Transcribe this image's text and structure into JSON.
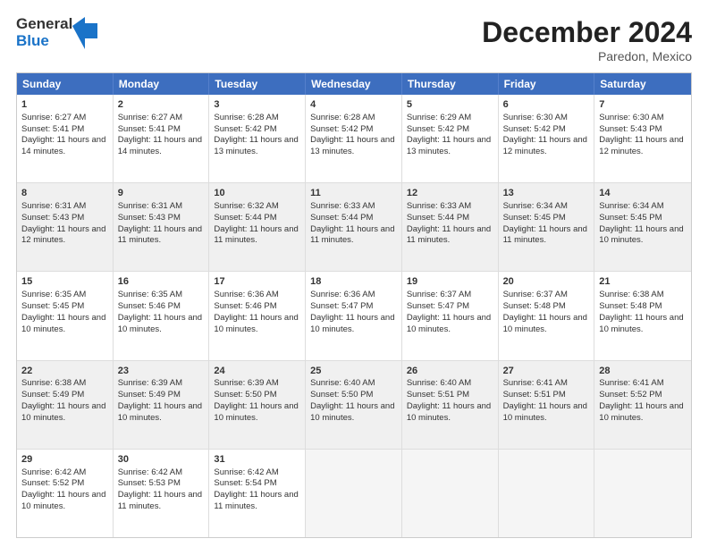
{
  "logo": {
    "line1": "General",
    "line2": "Blue"
  },
  "title": "December 2024",
  "location": "Paredon, Mexico",
  "header": {
    "days": [
      "Sunday",
      "Monday",
      "Tuesday",
      "Wednesday",
      "Thursday",
      "Friday",
      "Saturday"
    ]
  },
  "rows": [
    {
      "shaded": false,
      "cells": [
        {
          "day": "1",
          "sunrise": "Sunrise: 6:27 AM",
          "sunset": "Sunset: 5:41 PM",
          "daylight": "Daylight: 11 hours and 14 minutes."
        },
        {
          "day": "2",
          "sunrise": "Sunrise: 6:27 AM",
          "sunset": "Sunset: 5:41 PM",
          "daylight": "Daylight: 11 hours and 14 minutes."
        },
        {
          "day": "3",
          "sunrise": "Sunrise: 6:28 AM",
          "sunset": "Sunset: 5:42 PM",
          "daylight": "Daylight: 11 hours and 13 minutes."
        },
        {
          "day": "4",
          "sunrise": "Sunrise: 6:28 AM",
          "sunset": "Sunset: 5:42 PM",
          "daylight": "Daylight: 11 hours and 13 minutes."
        },
        {
          "day": "5",
          "sunrise": "Sunrise: 6:29 AM",
          "sunset": "Sunset: 5:42 PM",
          "daylight": "Daylight: 11 hours and 13 minutes."
        },
        {
          "day": "6",
          "sunrise": "Sunrise: 6:30 AM",
          "sunset": "Sunset: 5:42 PM",
          "daylight": "Daylight: 11 hours and 12 minutes."
        },
        {
          "day": "7",
          "sunrise": "Sunrise: 6:30 AM",
          "sunset": "Sunset: 5:43 PM",
          "daylight": "Daylight: 11 hours and 12 minutes."
        }
      ]
    },
    {
      "shaded": true,
      "cells": [
        {
          "day": "8",
          "sunrise": "Sunrise: 6:31 AM",
          "sunset": "Sunset: 5:43 PM",
          "daylight": "Daylight: 11 hours and 12 minutes."
        },
        {
          "day": "9",
          "sunrise": "Sunrise: 6:31 AM",
          "sunset": "Sunset: 5:43 PM",
          "daylight": "Daylight: 11 hours and 11 minutes."
        },
        {
          "day": "10",
          "sunrise": "Sunrise: 6:32 AM",
          "sunset": "Sunset: 5:44 PM",
          "daylight": "Daylight: 11 hours and 11 minutes."
        },
        {
          "day": "11",
          "sunrise": "Sunrise: 6:33 AM",
          "sunset": "Sunset: 5:44 PM",
          "daylight": "Daylight: 11 hours and 11 minutes."
        },
        {
          "day": "12",
          "sunrise": "Sunrise: 6:33 AM",
          "sunset": "Sunset: 5:44 PM",
          "daylight": "Daylight: 11 hours and 11 minutes."
        },
        {
          "day": "13",
          "sunrise": "Sunrise: 6:34 AM",
          "sunset": "Sunset: 5:45 PM",
          "daylight": "Daylight: 11 hours and 11 minutes."
        },
        {
          "day": "14",
          "sunrise": "Sunrise: 6:34 AM",
          "sunset": "Sunset: 5:45 PM",
          "daylight": "Daylight: 11 hours and 10 minutes."
        }
      ]
    },
    {
      "shaded": false,
      "cells": [
        {
          "day": "15",
          "sunrise": "Sunrise: 6:35 AM",
          "sunset": "Sunset: 5:45 PM",
          "daylight": "Daylight: 11 hours and 10 minutes."
        },
        {
          "day": "16",
          "sunrise": "Sunrise: 6:35 AM",
          "sunset": "Sunset: 5:46 PM",
          "daylight": "Daylight: 11 hours and 10 minutes."
        },
        {
          "day": "17",
          "sunrise": "Sunrise: 6:36 AM",
          "sunset": "Sunset: 5:46 PM",
          "daylight": "Daylight: 11 hours and 10 minutes."
        },
        {
          "day": "18",
          "sunrise": "Sunrise: 6:36 AM",
          "sunset": "Sunset: 5:47 PM",
          "daylight": "Daylight: 11 hours and 10 minutes."
        },
        {
          "day": "19",
          "sunrise": "Sunrise: 6:37 AM",
          "sunset": "Sunset: 5:47 PM",
          "daylight": "Daylight: 11 hours and 10 minutes."
        },
        {
          "day": "20",
          "sunrise": "Sunrise: 6:37 AM",
          "sunset": "Sunset: 5:48 PM",
          "daylight": "Daylight: 11 hours and 10 minutes."
        },
        {
          "day": "21",
          "sunrise": "Sunrise: 6:38 AM",
          "sunset": "Sunset: 5:48 PM",
          "daylight": "Daylight: 11 hours and 10 minutes."
        }
      ]
    },
    {
      "shaded": true,
      "cells": [
        {
          "day": "22",
          "sunrise": "Sunrise: 6:38 AM",
          "sunset": "Sunset: 5:49 PM",
          "daylight": "Daylight: 11 hours and 10 minutes."
        },
        {
          "day": "23",
          "sunrise": "Sunrise: 6:39 AM",
          "sunset": "Sunset: 5:49 PM",
          "daylight": "Daylight: 11 hours and 10 minutes."
        },
        {
          "day": "24",
          "sunrise": "Sunrise: 6:39 AM",
          "sunset": "Sunset: 5:50 PM",
          "daylight": "Daylight: 11 hours and 10 minutes."
        },
        {
          "day": "25",
          "sunrise": "Sunrise: 6:40 AM",
          "sunset": "Sunset: 5:50 PM",
          "daylight": "Daylight: 11 hours and 10 minutes."
        },
        {
          "day": "26",
          "sunrise": "Sunrise: 6:40 AM",
          "sunset": "Sunset: 5:51 PM",
          "daylight": "Daylight: 11 hours and 10 minutes."
        },
        {
          "day": "27",
          "sunrise": "Sunrise: 6:41 AM",
          "sunset": "Sunset: 5:51 PM",
          "daylight": "Daylight: 11 hours and 10 minutes."
        },
        {
          "day": "28",
          "sunrise": "Sunrise: 6:41 AM",
          "sunset": "Sunset: 5:52 PM",
          "daylight": "Daylight: 11 hours and 10 minutes."
        }
      ]
    },
    {
      "shaded": false,
      "cells": [
        {
          "day": "29",
          "sunrise": "Sunrise: 6:42 AM",
          "sunset": "Sunset: 5:52 PM",
          "daylight": "Daylight: 11 hours and 10 minutes."
        },
        {
          "day": "30",
          "sunrise": "Sunrise: 6:42 AM",
          "sunset": "Sunset: 5:53 PM",
          "daylight": "Daylight: 11 hours and 11 minutes."
        },
        {
          "day": "31",
          "sunrise": "Sunrise: 6:42 AM",
          "sunset": "Sunset: 5:54 PM",
          "daylight": "Daylight: 11 hours and 11 minutes."
        },
        {
          "day": "",
          "sunrise": "",
          "sunset": "",
          "daylight": ""
        },
        {
          "day": "",
          "sunrise": "",
          "sunset": "",
          "daylight": ""
        },
        {
          "day": "",
          "sunrise": "",
          "sunset": "",
          "daylight": ""
        },
        {
          "day": "",
          "sunrise": "",
          "sunset": "",
          "daylight": ""
        }
      ]
    }
  ]
}
